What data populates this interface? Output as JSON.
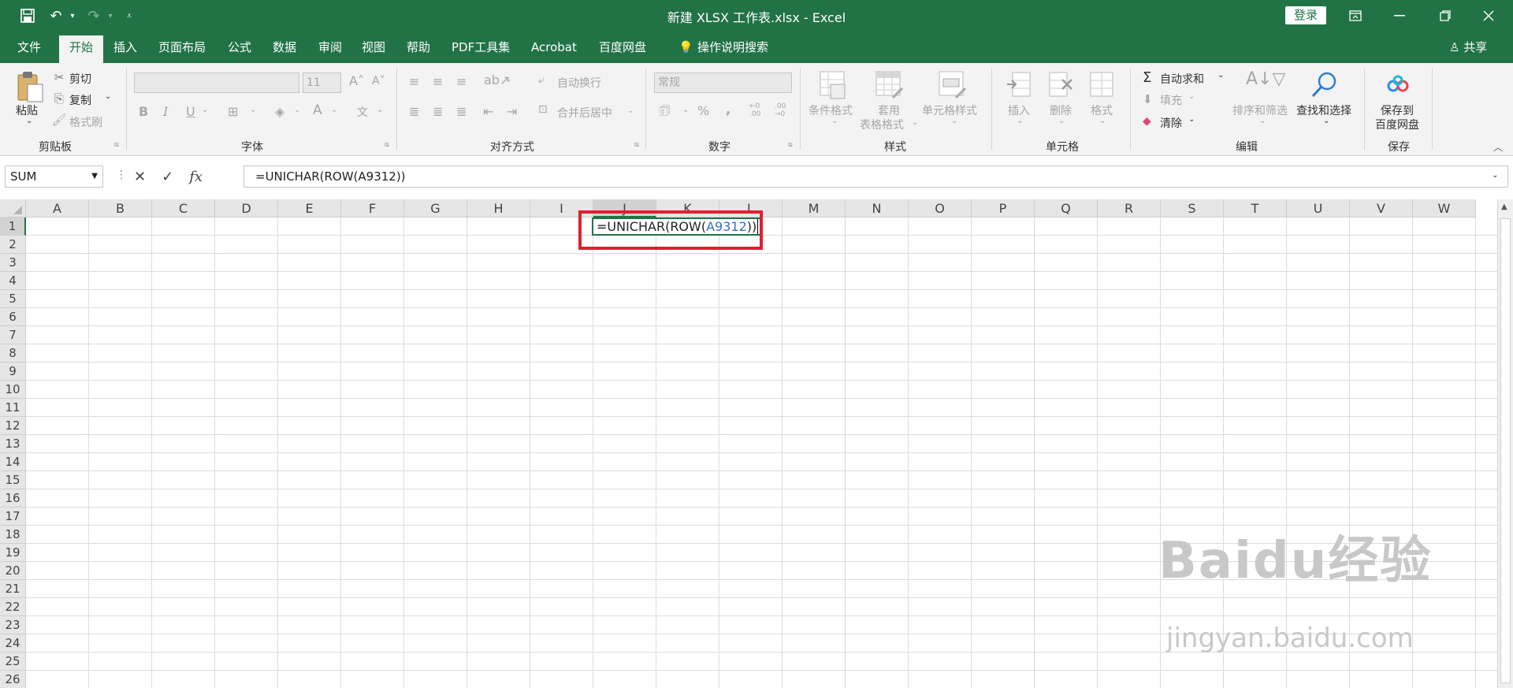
{
  "app": {
    "title": "新建 XLSX 工作表.xlsx  -  Excel",
    "login": "登录",
    "share": "共享"
  },
  "tabs": [
    "文件",
    "开始",
    "插入",
    "页面布局",
    "公式",
    "数据",
    "审阅",
    "视图",
    "帮助",
    "PDF工具集",
    "Acrobat",
    "百度网盘"
  ],
  "search_hint": "操作说明搜索",
  "ribbon": {
    "clipboard": {
      "paste": "粘贴",
      "cut": "剪切",
      "copy": "复制",
      "format_painter": "格式刷",
      "label": "剪贴板"
    },
    "font": {
      "font_size": "11",
      "label": "字体"
    },
    "alignment": {
      "wrap": "自动换行",
      "merge": "合并后居中",
      "label": "对齐方式"
    },
    "number": {
      "format": "常规",
      "label": "数字"
    },
    "styles": {
      "conditional": "条件格式",
      "table1": "套用",
      "table2": "表格格式",
      "cell_styles": "单元格样式",
      "label": "样式"
    },
    "cells": {
      "insert": "插入",
      "delete": "删除",
      "format": "格式",
      "label": "单元格"
    },
    "editing": {
      "autosum": "自动求和",
      "fill": "填充",
      "clear": "清除",
      "sort": "排序和筛选",
      "find": "查找和选择",
      "label": "编辑"
    },
    "save": {
      "save1": "保存到",
      "save2": "百度网盘",
      "label": "保存"
    }
  },
  "formula_bar": {
    "name_box": "SUM",
    "formula": "=UNICHAR(ROW(A9312))"
  },
  "grid": {
    "columns": [
      "A",
      "B",
      "C",
      "D",
      "E",
      "F",
      "G",
      "H",
      "I",
      "J",
      "K",
      "L",
      "M",
      "N",
      "O",
      "P",
      "Q",
      "R",
      "S",
      "T",
      "U",
      "V",
      "W"
    ],
    "rows": [
      "1",
      "2",
      "3",
      "4",
      "5",
      "6",
      "7",
      "8",
      "9",
      "10",
      "11",
      "12",
      "13",
      "14",
      "15",
      "16",
      "17",
      "18",
      "19",
      "20",
      "21",
      "22",
      "23",
      "24",
      "25",
      "26"
    ],
    "editing_cell": {
      "prefix": "=UNICHAR(ROW(",
      "ref": "A9312",
      "suffix": "))"
    }
  },
  "watermark": {
    "line1": "Baidu经验",
    "line2": "jingyan.baidu.com"
  },
  "colors": {
    "accent": "#217346",
    "highlight": "#e02030"
  }
}
